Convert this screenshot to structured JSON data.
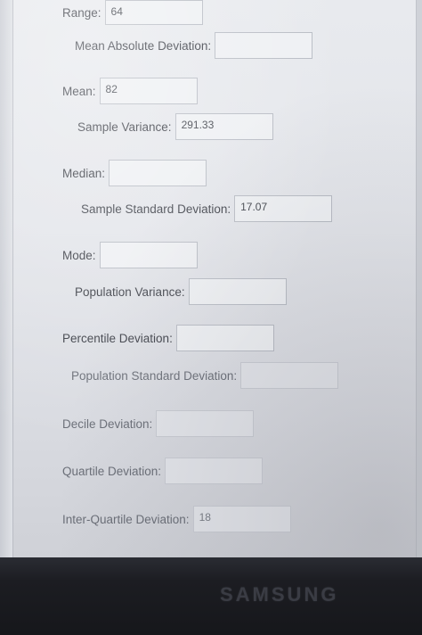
{
  "form": {
    "range": {
      "label": "Range:",
      "value": "64"
    },
    "mean_absolute_deviation": {
      "label": "Mean Absolute Deviation:",
      "value": ""
    },
    "mean": {
      "label": "Mean:",
      "value": "82"
    },
    "sample_variance": {
      "label": "Sample Variance:",
      "value": "291.33"
    },
    "median": {
      "label": "Median:",
      "value": ""
    },
    "sample_standard_deviation": {
      "label": "Sample Standard Deviation:",
      "value": "17.07"
    },
    "mode": {
      "label": "Mode:",
      "value": ""
    },
    "population_variance": {
      "label": "Population Variance:",
      "value": ""
    },
    "percentile_deviation": {
      "label": "Percentile Deviation:",
      "value": ""
    },
    "population_standard_deviation": {
      "label": "Population Standard Deviation:",
      "value": ""
    },
    "decile_deviation": {
      "label": "Decile Deviation:",
      "value": ""
    },
    "quartile_deviation": {
      "label": "Quartile Deviation:",
      "value": ""
    },
    "inter_quartile_deviation": {
      "label": "Inter-Quartile Deviation:",
      "value": "18"
    }
  },
  "monitor": {
    "brand": "SAMSUNG"
  }
}
